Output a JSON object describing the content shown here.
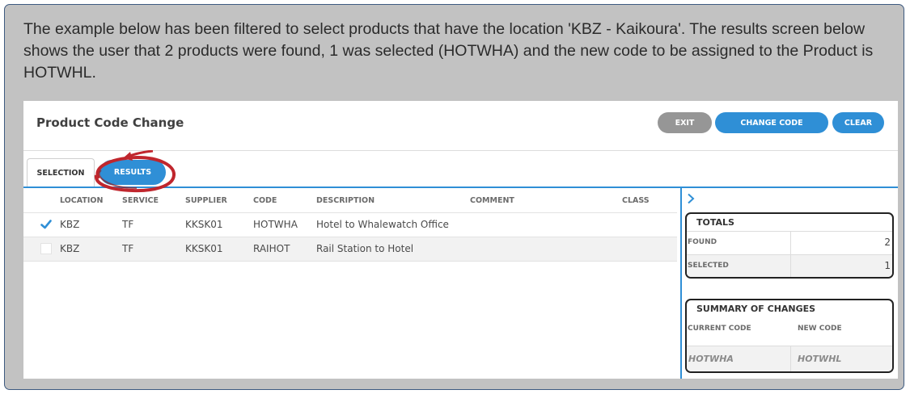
{
  "intro_text": "The example below has been filtered to select products that have the location 'KBZ - Kaikoura'. The results screen below shows the user that 2 products were found, 1 was selected (HOTWHA) and the new code to be assigned to the Product is HOTWHL.",
  "header": {
    "title": "Product Code Change",
    "buttons": {
      "exit": "EXIT",
      "change_code": "CHANGE CODE",
      "clear": "CLEAR"
    }
  },
  "tabs": {
    "selection": "SELECTION",
    "results": "RESULTS",
    "active": "results"
  },
  "table": {
    "columns": [
      "LOCATION",
      "SERVICE",
      "SUPPLIER",
      "CODE",
      "DESCRIPTION",
      "COMMENT",
      "CLASS"
    ],
    "rows": [
      {
        "checked": true,
        "location": "KBZ",
        "service": "TF",
        "supplier": "KKSK01",
        "code": "HOTWHA",
        "description": "Hotel to Whalewatch Office",
        "comment": "",
        "class": ""
      },
      {
        "checked": false,
        "location": "KBZ",
        "service": "TF",
        "supplier": "KKSK01",
        "code": "RAIHOT",
        "description": "Rail Station to Hotel",
        "comment": "",
        "class": ""
      }
    ]
  },
  "totals": {
    "title": "TOTALS",
    "found_label": "FOUND",
    "found_value": "2",
    "selected_label": "SELECTED",
    "selected_value": "1"
  },
  "summary": {
    "title": "SUMMARY OF CHANGES",
    "current_code_label": "CURRENT CODE",
    "new_code_label": "NEW CODE",
    "current_code": "HOTWHA",
    "new_code": "HOTWHL"
  },
  "colors": {
    "accent": "#2f8fd6",
    "annotation": "#c0262d",
    "callout_bg": "#c2c2c2"
  },
  "icons": {
    "checkbox_checked": "check-icon",
    "panel_toggle": "chevron-right-icon"
  }
}
